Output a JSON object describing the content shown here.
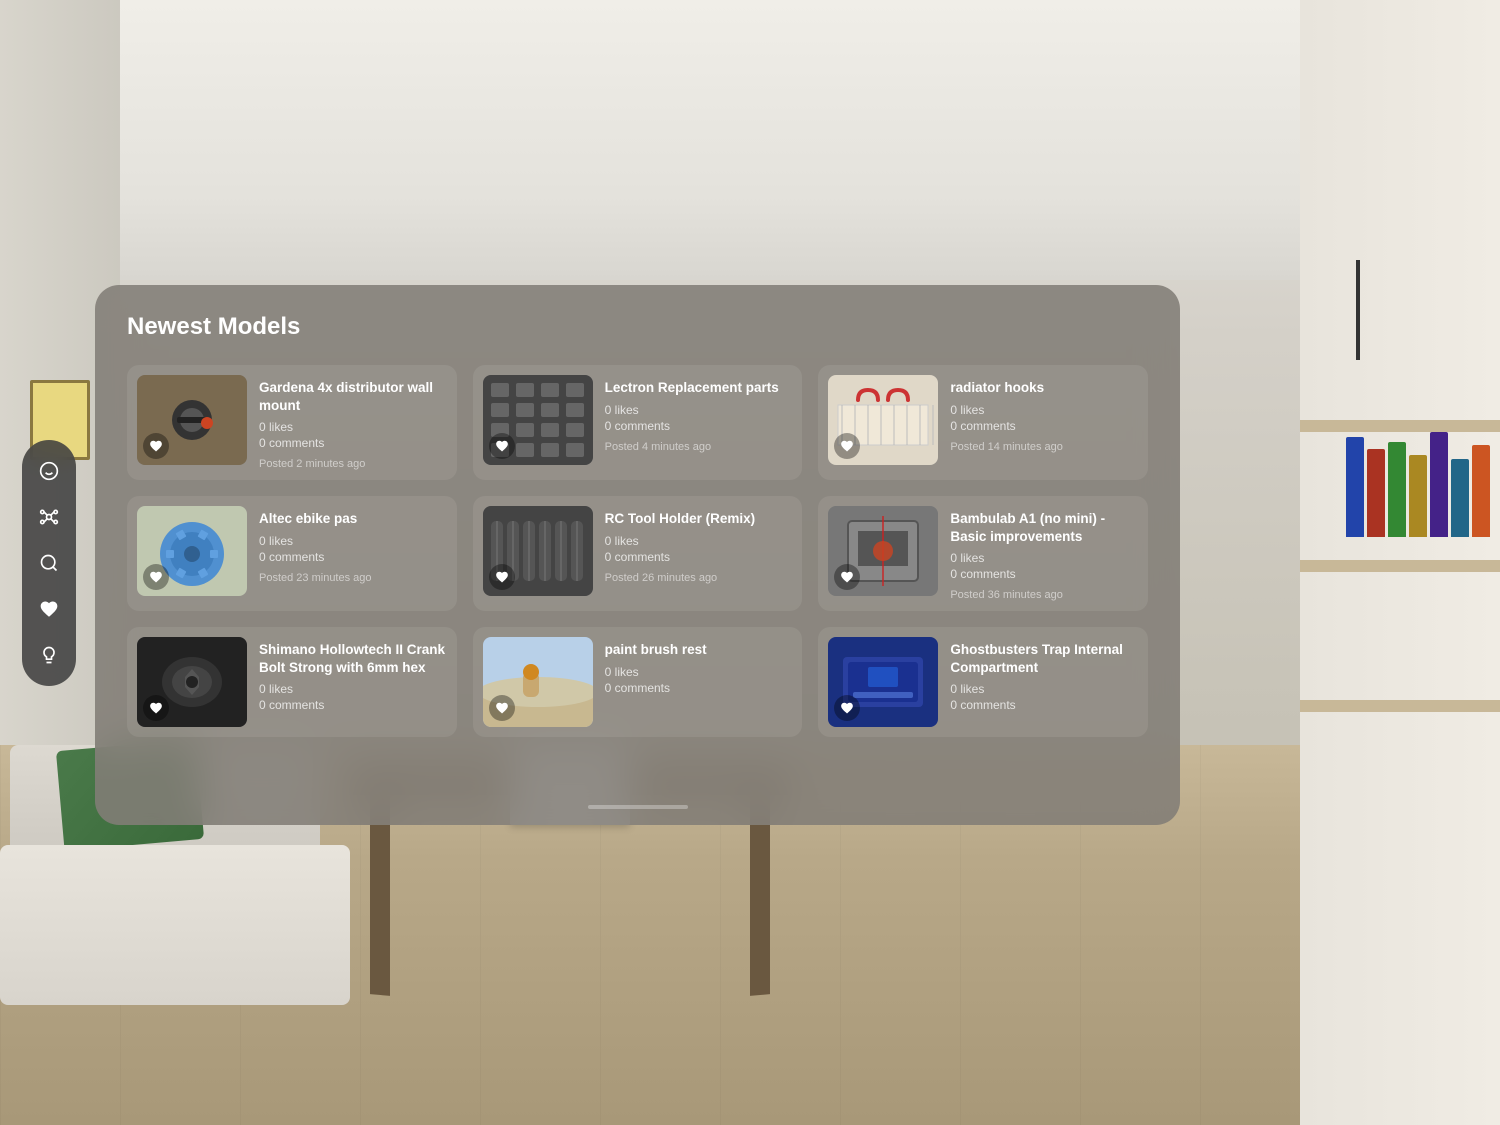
{
  "panel": {
    "title": "Newest Models"
  },
  "sidebar": {
    "items": [
      {
        "icon": "flame",
        "label": "Trending",
        "active": false,
        "symbol": "🔥"
      },
      {
        "icon": "network",
        "label": "Network",
        "active": false,
        "symbol": "⚙"
      },
      {
        "icon": "search",
        "label": "Search",
        "active": false,
        "symbol": "🔍"
      },
      {
        "icon": "heart",
        "label": "Liked",
        "active": false,
        "symbol": "♥"
      },
      {
        "icon": "lightbulb",
        "label": "Ideas",
        "active": false,
        "symbol": "💡"
      }
    ]
  },
  "models": [
    {
      "id": 1,
      "name": "Gardena 4x distributor wall mount",
      "likes": "0 likes",
      "comments": "0 comments",
      "posted": "Posted 2 minutes ago",
      "thumb_color1": "#7a6a50",
      "thumb_color2": "#9a8a70"
    },
    {
      "id": 2,
      "name": "Lectron Replacement parts",
      "likes": "0 likes",
      "comments": "0 comments",
      "posted": "Posted 4 minutes ago",
      "thumb_color1": "#555555",
      "thumb_color2": "#444444"
    },
    {
      "id": 3,
      "name": "radiator hooks",
      "likes": "0 likes",
      "comments": "0 comments",
      "posted": "Posted 14 minutes ago",
      "thumb_color1": "#d0c8b8",
      "thumb_color2": "#e0d8c8"
    },
    {
      "id": 4,
      "name": "Altec ebike pas",
      "likes": "0 likes",
      "comments": "0 comments",
      "posted": "Posted 23 minutes ago",
      "thumb_color1": "#4a90d0",
      "thumb_color2": "#3a80c0"
    },
    {
      "id": 5,
      "name": "RC Tool Holder (Remix)",
      "likes": "0 likes",
      "comments": "0 comments",
      "posted": "Posted 26 minutes ago",
      "thumb_color1": "#555555",
      "thumb_color2": "#333333"
    },
    {
      "id": 6,
      "name": "Bambulab A1 (no mini) - Basic improvements",
      "likes": "0 likes",
      "comments": "0 comments",
      "posted": "Posted 36 minutes ago",
      "thumb_color1": "#888888",
      "thumb_color2": "#666666"
    },
    {
      "id": 7,
      "name": "Shimano Hollowtech II Crank Bolt Strong with 6mm hex",
      "likes": "0 likes",
      "comments": "0 comments",
      "posted": "",
      "thumb_color1": "#222222",
      "thumb_color2": "#111111"
    },
    {
      "id": 8,
      "name": "paint brush rest",
      "likes": "0 likes",
      "comments": "0 comments",
      "posted": "",
      "thumb_color1": "#b0c8e0",
      "thumb_color2": "#90a8c0"
    },
    {
      "id": 9,
      "name": "Ghostbusters Trap Internal Compartment",
      "likes": "0 likes",
      "comments": "0 comments",
      "posted": "",
      "thumb_color1": "#1a3080",
      "thumb_color2": "#102060"
    }
  ]
}
